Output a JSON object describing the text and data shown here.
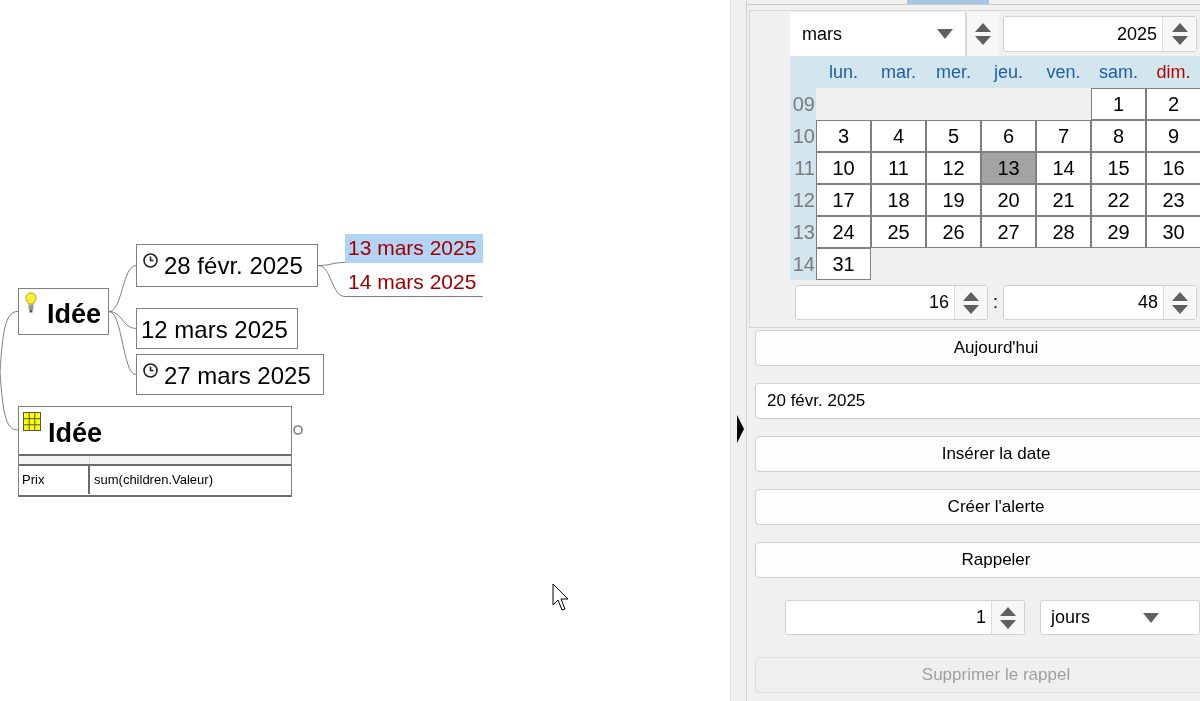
{
  "mind_map": {
    "nodes": [
      {
        "kind": "idea",
        "text": "Idée",
        "selected": false,
        "folded": false,
        "children": [
          {
            "kind": "bubble",
            "text": "28 févr. 2025",
            "reminder": true,
            "selected": false,
            "children": [
              {
                "kind": "fork",
                "text": "13 mars 2025",
                "selected": true
              },
              {
                "kind": "fork",
                "text": "14 mars 2025",
                "selected": false
              }
            ]
          },
          {
            "kind": "bubble",
            "text": "12 mars 2025",
            "reminder": false,
            "selected": false
          },
          {
            "kind": "bubble",
            "text": "27 mars 2025",
            "reminder": true,
            "selected": false
          }
        ]
      },
      {
        "kind": "attributes",
        "text": "Idée",
        "selected": false,
        "folded": true,
        "attributes": [
          {
            "name": "Prix",
            "value": "sum(children.Valeur)"
          }
        ]
      }
    ]
  },
  "calendar": {
    "month": "mars",
    "year": "2025",
    "weekdays": [
      {
        "label": "lun.",
        "color": "#1f5fa6"
      },
      {
        "label": "mar.",
        "color": "#1f5fa6"
      },
      {
        "label": "mer.",
        "color": "#1f5fa6"
      },
      {
        "label": "jeu.",
        "color": "#1f5fa6"
      },
      {
        "label": "ven.",
        "color": "#1f5fa6"
      },
      {
        "label": "sam.",
        "color": "#1f5fa6"
      },
      {
        "label": "dim.",
        "color": "#b40000"
      }
    ],
    "weeks": [
      {
        "number": "09",
        "days": [
          {
            "label": "1",
            "selected": false
          },
          {
            "label": "2",
            "selected": false
          }
        ]
      },
      {
        "number": "10",
        "days": [
          {
            "label": "3",
            "selected": false
          },
          {
            "label": "4",
            "selected": false
          },
          {
            "label": "5",
            "selected": false
          },
          {
            "label": "6",
            "selected": false
          },
          {
            "label": "7",
            "selected": false
          },
          {
            "label": "8",
            "selected": false
          },
          {
            "label": "9",
            "selected": false
          }
        ]
      },
      {
        "number": "11",
        "days": [
          {
            "label": "10",
            "selected": false
          },
          {
            "label": "11",
            "selected": false
          },
          {
            "label": "12",
            "selected": false
          },
          {
            "label": "13",
            "selected": true
          },
          {
            "label": "14",
            "selected": false
          },
          {
            "label": "15",
            "selected": false
          },
          {
            "label": "16",
            "selected": false
          }
        ]
      },
      {
        "number": "12",
        "days": [
          {
            "label": "17",
            "selected": false
          },
          {
            "label": "18",
            "selected": false
          },
          {
            "label": "19",
            "selected": false
          },
          {
            "label": "20",
            "selected": false
          },
          {
            "label": "21",
            "selected": false
          },
          {
            "label": "22",
            "selected": false
          },
          {
            "label": "23",
            "selected": false
          }
        ]
      },
      {
        "number": "13",
        "days": [
          {
            "label": "24",
            "selected": false
          },
          {
            "label": "25",
            "selected": false
          },
          {
            "label": "26",
            "selected": false
          },
          {
            "label": "27",
            "selected": false
          },
          {
            "label": "28",
            "selected": false
          },
          {
            "label": "29",
            "selected": false
          },
          {
            "label": "30",
            "selected": false
          }
        ]
      },
      {
        "number": "14",
        "days": [
          {
            "label": "31",
            "selected": false
          }
        ]
      }
    ],
    "hour": "16",
    "separator": ":",
    "minute": "48"
  },
  "controls": [
    {
      "kind": "button",
      "label": "Aujourd'hui",
      "disabled": false
    },
    {
      "kind": "field",
      "value": "20 févr. 2025"
    },
    {
      "kind": "button",
      "label": "Insérer la date",
      "disabled": false
    },
    {
      "kind": "button",
      "label": "Créer l'alerte",
      "disabled": false
    },
    {
      "kind": "button",
      "label": "Rappeler",
      "disabled": false
    },
    {
      "kind": "interval",
      "value": "1",
      "unit": "jours"
    },
    {
      "kind": "button",
      "label": "Supprimer le rappel",
      "disabled": true
    }
  ]
}
